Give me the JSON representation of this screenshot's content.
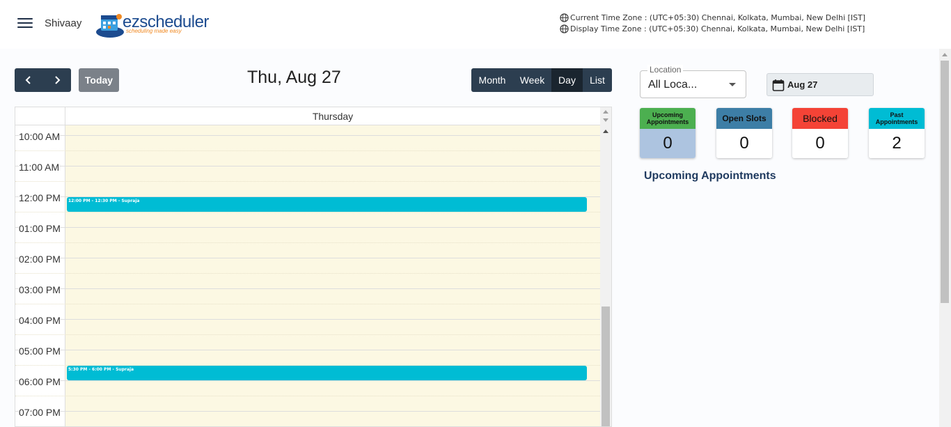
{
  "header": {
    "user_name": "Shivaay",
    "logo_text_ez": "ez",
    "logo_text_scheduler": "scheduler",
    "logo_tagline": "scheduling made easy",
    "current_timezone": "Current Time Zone : (UTC+05:30) Chennai, Kolkata, Mumbai, New Delhi [IST]",
    "display_timezone": "Display Time Zone : (UTC+05:30) Chennai, Kolkata, Mumbai, New Delhi [IST]"
  },
  "toolbar": {
    "prev_icon": "chevron-left-icon",
    "next_icon": "chevron-right-icon",
    "today_label": "Today",
    "title": "Thu, Aug 27",
    "views": [
      {
        "label": "Month",
        "active": false
      },
      {
        "label": "Week",
        "active": false
      },
      {
        "label": "Day",
        "active": true
      },
      {
        "label": "List",
        "active": false
      }
    ]
  },
  "calendar": {
    "day_header": "Thursday",
    "times": [
      "10:00 AM",
      "11:00 AM",
      "12:00 PM",
      "01:00 PM",
      "02:00 PM",
      "03:00 PM",
      "04:00 PM",
      "05:00 PM",
      "06:00 PM",
      "07:00 PM"
    ],
    "events": [
      {
        "label": "12:00 PM - 12:30 PM - Supraja"
      },
      {
        "label": "5:30 PM - 6:00 PM - Supraja"
      }
    ],
    "day_bg_color": "#fcf8e3",
    "event_color": "#00bcd4"
  },
  "sidebar": {
    "location_label": "Location",
    "location_value": "All Loca...",
    "date_value": "Aug 27",
    "stats": [
      {
        "label": "Upcoming Appointments",
        "value": "0",
        "head_color": "#4caf50",
        "body_color": "#adc4e0",
        "head_text_color": "#111"
      },
      {
        "label": "Open Slots",
        "value": "0",
        "head_color": "#3d7ea6",
        "body_color": "#ffffff",
        "head_text_color": "#111"
      },
      {
        "label": "Blocked",
        "value": "0",
        "head_color": "#f44336",
        "body_color": "#ffffff",
        "head_text_color": "#111"
      },
      {
        "label": "Past Appointments",
        "value": "2",
        "head_color": "#00bcd4",
        "body_color": "#ffffff",
        "head_text_color": "#111"
      }
    ],
    "upcoming_title": "Upcoming Appointments"
  }
}
